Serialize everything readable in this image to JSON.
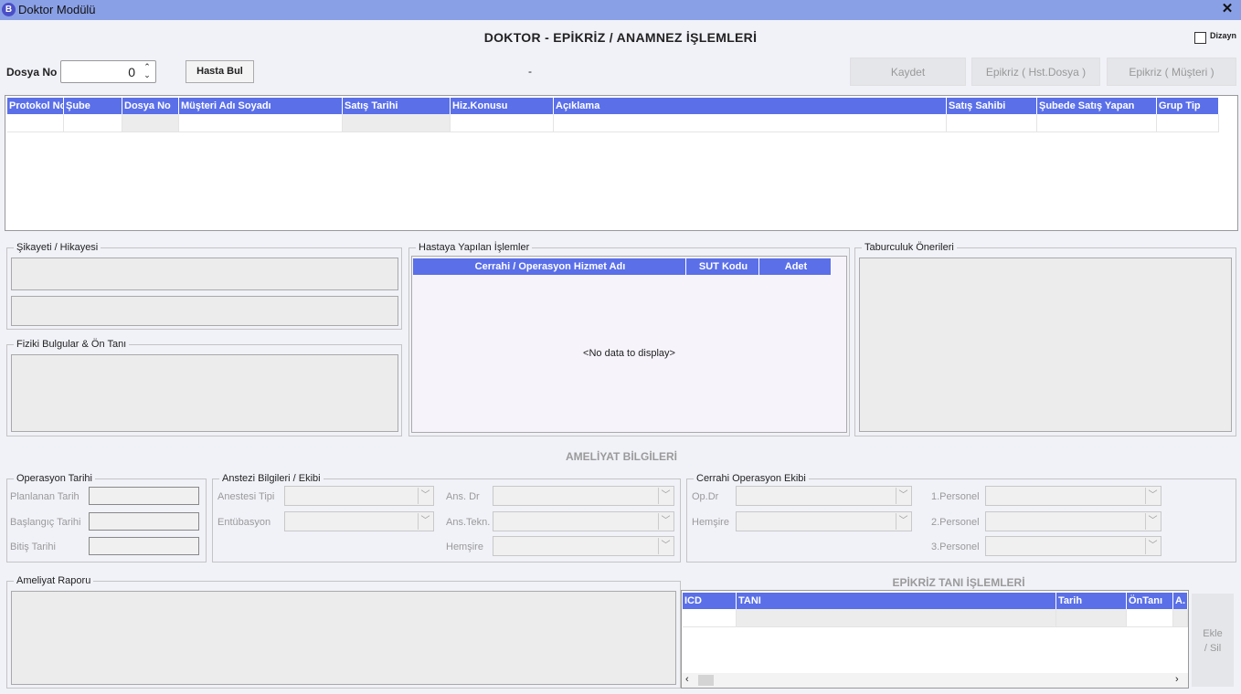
{
  "window": {
    "title": "Doktor Modülü",
    "logo_letter": "B",
    "close": "✕"
  },
  "header": {
    "title": "DOKTOR - EPİKRİZ / ANAMNEZ İŞLEMLERİ",
    "dizayn_label": "Dizayn"
  },
  "search": {
    "dosya_label": "Dosya No",
    "dosya_value": "0",
    "hasta_bul": "Hasta Bul",
    "patient_name": "-"
  },
  "actions": {
    "kaydet": "Kaydet",
    "epikriz_hst": "Epikriz ( Hst.Dosya )",
    "epikriz_musteri": "Epikriz ( Müşteri )"
  },
  "main_grid": {
    "columns": [
      "Protokol No",
      "Şube",
      "Dosya No",
      "Müşteri Adı Soyadı",
      "Satış Tarihi",
      "Hiz.Konusu",
      "Açıklama",
      "Satış Sahibi",
      "Şubede Satış Yapan",
      "Grup Tip"
    ]
  },
  "sikayet": {
    "title": "Şikayeti / Hikayesi"
  },
  "fiziki": {
    "title": "Fiziki Bulgular  & Ön Tanı"
  },
  "islemler": {
    "title": "Hastaya Yapılan İşlemler",
    "columns": [
      "Cerrahi / Operasyon Hizmet Adı",
      "SUT Kodu",
      "Adet"
    ],
    "empty": "<No data to display>"
  },
  "taburculuk": {
    "title": "Taburculuk Önerileri"
  },
  "ameliyat": {
    "header": "AMELİYAT BİLGİLERİ",
    "op_tarihi": {
      "title": "Operasyon Tarihi",
      "planlanan": "Planlanan Tarih",
      "baslangic": "Başlangıç Tarihi",
      "bitis": "Bitiş Tarihi"
    },
    "anestezi": {
      "title": "Anstezi Bilgileri / Ekibi",
      "tipi": "Anestesi Tipi",
      "entubasyon": "Entübasyon",
      "ans_dr": "Ans. Dr",
      "ans_tekn": "Ans.Tekn.",
      "hemsire": "Hemşire"
    },
    "cerrahi": {
      "title": "Cerrahi Operasyon Ekibi",
      "op_dr": "Op.Dr",
      "hemsire": "Hemşire",
      "p1": "1.Personel",
      "p2": "2.Personel",
      "p3": "3.Personel"
    },
    "rapor": {
      "title": "Ameliyat Raporu"
    }
  },
  "epikriz": {
    "header": "EPİKRİZ TANI İŞLEMLERİ",
    "columns": [
      "ICD",
      "TANI",
      "Tarih",
      "ÖnTanı",
      "A."
    ],
    "ekle": "Ekle",
    "sil": "/ Sil"
  }
}
